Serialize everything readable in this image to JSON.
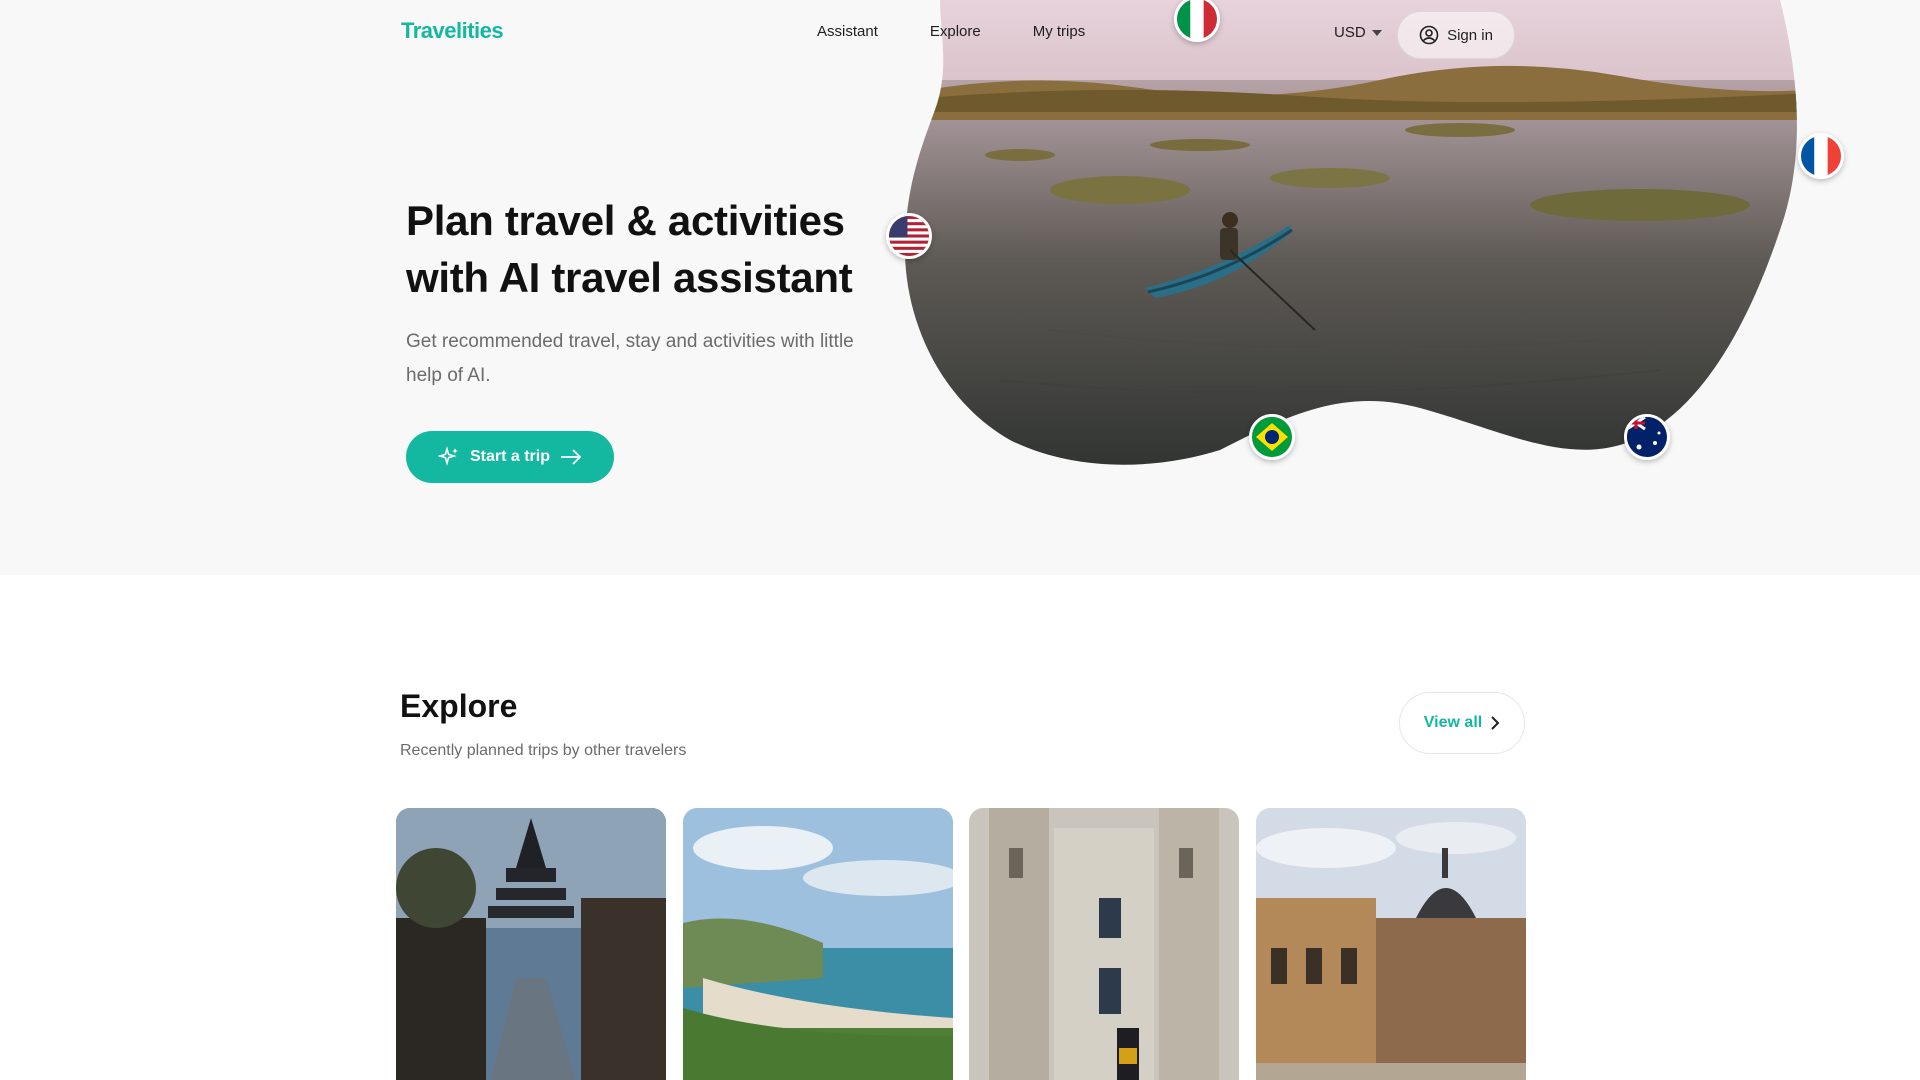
{
  "brand": {
    "name": "Travelities",
    "accent": "#14b8a0"
  },
  "nav": {
    "links": [
      {
        "label": "Assistant"
      },
      {
        "label": "Explore"
      },
      {
        "label": "My trips"
      }
    ],
    "currency": "USD",
    "sign_in": "Sign in"
  },
  "hero": {
    "title": "Plan travel & activities with AI travel assistant",
    "subtitle": "Get recommended travel, stay and activities with little help of AI.",
    "cta_label": "Start a trip",
    "flags": [
      "italy-flag",
      "usa-flag",
      "france-flag",
      "brazil-flag",
      "australia-flag"
    ]
  },
  "explore": {
    "title": "Explore",
    "subtitle": "Recently planned trips by other travelers",
    "view_all": "View all",
    "cards": [
      {
        "image": "kyoto-pagoda-street"
      },
      {
        "image": "coastal-beach"
      },
      {
        "image": "gothic-cathedral"
      },
      {
        "image": "european-palace-square"
      }
    ]
  }
}
